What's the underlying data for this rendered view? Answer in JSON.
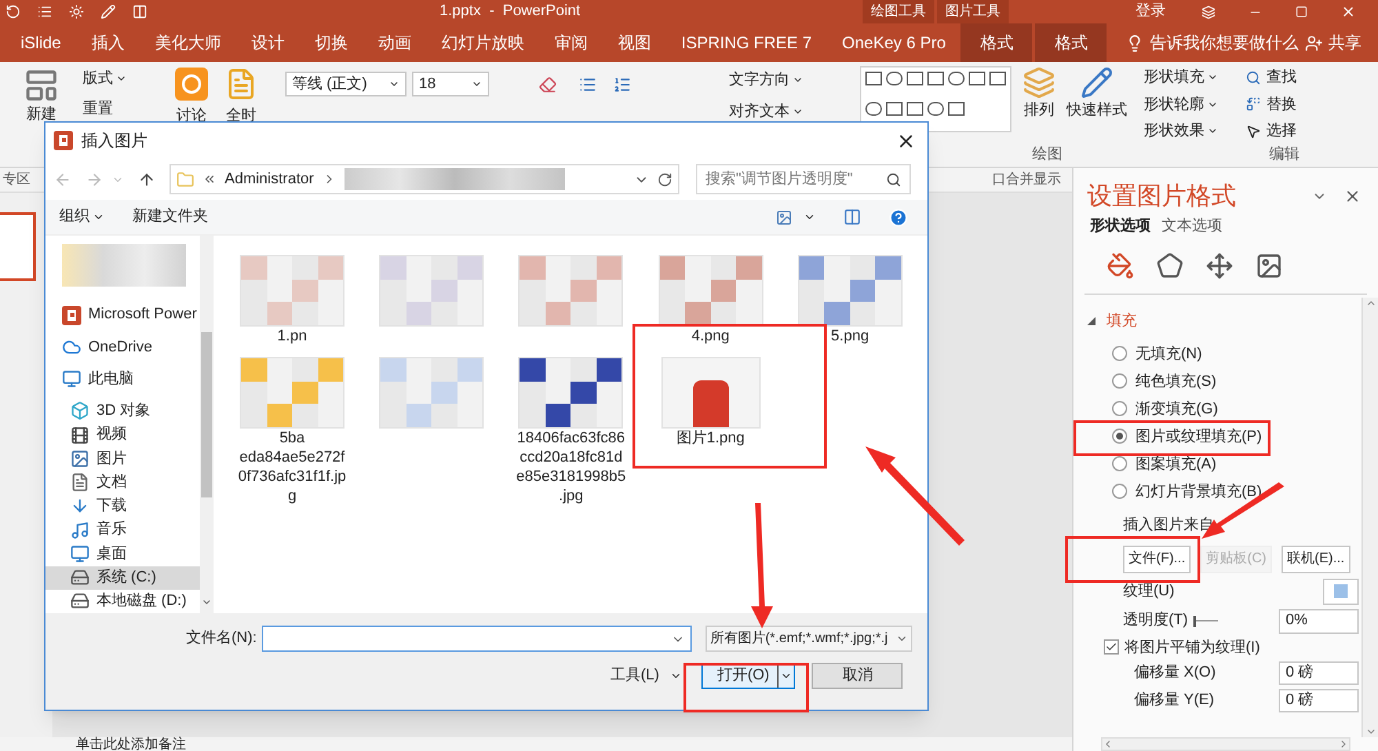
{
  "title_bar": {
    "title": "1.pptx  -  PowerPoint",
    "context_groups": [
      "绘图工具",
      "图片工具"
    ],
    "sign_in": "登录"
  },
  "tabs": [
    {
      "label": "iSlide",
      "kind": "normal"
    },
    {
      "label": "插入",
      "kind": "normal"
    },
    {
      "label": "美化大师",
      "kind": "normal"
    },
    {
      "label": "设计",
      "kind": "normal"
    },
    {
      "label": "切换",
      "kind": "normal"
    },
    {
      "label": "动画",
      "kind": "normal"
    },
    {
      "label": "幻灯片放映",
      "kind": "normal"
    },
    {
      "label": "审阅",
      "kind": "normal"
    },
    {
      "label": "视图",
      "kind": "normal"
    },
    {
      "label": "ISPRING FREE 7",
      "kind": "normal"
    },
    {
      "label": "OneKey 6 Pro",
      "kind": "normal"
    },
    {
      "label": "格式",
      "kind": "contextual"
    },
    {
      "label": "格式",
      "kind": "contextual"
    }
  ],
  "tell_me": "告诉我你想要做什么",
  "share": "共享",
  "ribbon": {
    "new_slide": "新建",
    "layout": "版式",
    "reset": "重置",
    "discuss": "讨论",
    "quanshi": "全时",
    "font": "等线 (正文)",
    "font_size": "18",
    "text_direction": "文字方向",
    "align_text": "对齐文本",
    "arrange": "排列",
    "quick_styles": "快速样式",
    "shape_fill": "形状填充",
    "shape_outline": "形状轮廓",
    "shape_effects": "形状效果",
    "find": "查找",
    "replace": "替换",
    "select": "选择",
    "groups": [
      "绘图",
      "编辑"
    ]
  },
  "strip": {
    "left": "专区",
    "right": "口合并显示"
  },
  "notes_placeholder": "单击此处添加备注",
  "dialog": {
    "title": "插入图片",
    "path_root": "Administrator",
    "search_placeholder": "搜索\"调节图片透明度\"",
    "organize": "组织",
    "new_folder": "新建文件夹",
    "nav": [
      {
        "label": "Microsoft Power",
        "kind": "app",
        "selected": false
      },
      {
        "label": "OneDrive",
        "kind": "cloud",
        "selected": false
      },
      {
        "label": "此电脑",
        "kind": "pc",
        "selected": false
      },
      {
        "label": "3D 对象",
        "kind": "objects",
        "selected": false
      },
      {
        "label": "视频",
        "kind": "video",
        "selected": false
      },
      {
        "label": "图片",
        "kind": "pictures",
        "selected": false
      },
      {
        "label": "文档",
        "kind": "docs",
        "selected": false
      },
      {
        "label": "下载",
        "kind": "downloads",
        "selected": false
      },
      {
        "label": "音乐",
        "kind": "music",
        "selected": false
      },
      {
        "label": "桌面",
        "kind": "desktop",
        "selected": false
      },
      {
        "label": "系统 (C:)",
        "kind": "drive",
        "selected": true
      },
      {
        "label": "本地磁盘 (D:)",
        "kind": "drive",
        "selected": false
      }
    ],
    "files": [
      {
        "kind": "blurred",
        "name_lines": [
          "1.pn"
        ]
      },
      {
        "kind": "blurred"
      },
      {
        "kind": "blurred"
      },
      {
        "kind": "blurred",
        "name_lines": [
          "4.png"
        ]
      },
      {
        "kind": "blurred",
        "name_lines": [
          "5.png"
        ]
      },
      {
        "kind": "blurred",
        "name_lines": [
          "5ba",
          "eda84ae5e272f",
          "0f736afc31f1f.jp",
          "g"
        ]
      },
      {
        "kind": "blurred"
      },
      {
        "kind": "blurred",
        "name_lines": [
          "18406fac63fc86",
          "ccd20a18fc81d",
          "e85e3181998b5",
          ".jpg"
        ]
      },
      {
        "kind": "photo",
        "name_lines": [
          "图片1.png"
        ]
      }
    ],
    "file_name_label": "文件名(N):",
    "file_type": "所有图片(*.emf;*.wmf;*.jpg;*.j",
    "tools": "工具(L)",
    "open": "打开(O)",
    "cancel": "取消"
  },
  "format_pane": {
    "title": "设置图片格式",
    "tabs": [
      {
        "label": "形状选项",
        "selected": true
      },
      {
        "label": "文本选项",
        "selected": false
      }
    ],
    "icon_tabs": [
      {
        "kind": "fill",
        "selected": true
      },
      {
        "kind": "shape",
        "selected": false
      },
      {
        "kind": "size",
        "selected": false
      },
      {
        "kind": "picture",
        "selected": false
      }
    ],
    "section": {
      "label": "填充",
      "expanded": true
    },
    "fill_options": [
      {
        "label": "无填充(N)",
        "selected": false
      },
      {
        "label": "纯色填充(S)",
        "selected": false
      },
      {
        "label": "渐变填充(G)",
        "selected": false
      },
      {
        "label": "图片或纹理填充(P)",
        "selected": true
      },
      {
        "label": "图案填充(A)",
        "selected": false
      },
      {
        "label": "幻灯片背景填充(B)",
        "selected": false
      }
    ],
    "insert_from": "插入图片来自",
    "source_buttons": [
      {
        "label": "文件(F)...",
        "disabled": false
      },
      {
        "label": "剪贴板(C)",
        "disabled": true
      },
      {
        "label": "联机(E)...",
        "disabled": false
      }
    ],
    "texture_label": "纹理(U)",
    "transparency": {
      "label": "透明度(T)",
      "level": 0,
      "value": "0%"
    },
    "tile": {
      "label": "将图片平铺为纹理(I)",
      "checked": true
    },
    "offsets": [
      {
        "label": "偏移量 X(O)",
        "value": "0 磅"
      },
      {
        "label": "偏移量 Y(E)",
        "value": "0 磅"
      }
    ]
  }
}
